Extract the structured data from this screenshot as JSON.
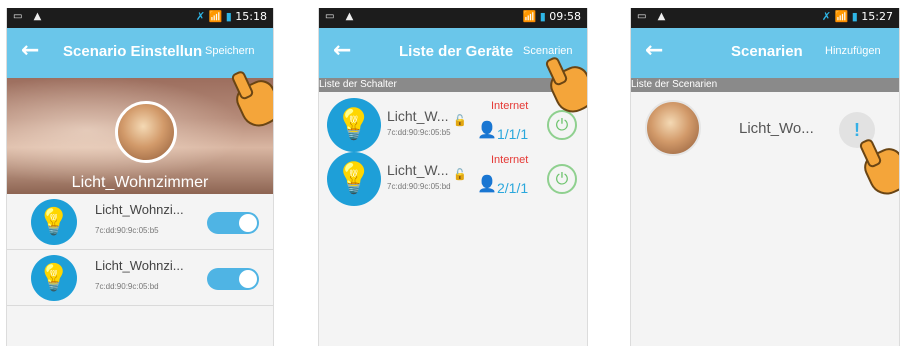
{
  "screens": [
    {
      "status": {
        "left_icons": "▭ ▲",
        "right_icons": "✗ 📶 ▮",
        "time": "15:18"
      },
      "appbar": {
        "back": "←",
        "title": "Scenario Einstellung",
        "action": "Speichern"
      },
      "scenario_name": "Licht_Wohnzimmer",
      "devices": [
        {
          "name": "Licht_Wohnzi...",
          "mac": "7c:dd:90:9c:05:b5",
          "on": true
        },
        {
          "name": "Licht_Wohnzi...",
          "mac": "7c:dd:90:9c:05:bd",
          "on": true
        }
      ]
    },
    {
      "status": {
        "left_icons": "▭ ▲",
        "right_icons": "📶 ▮",
        "time": "09:58"
      },
      "appbar": {
        "back": "←",
        "title": "Liste der Geräte",
        "action": "Scenarien"
      },
      "section": "Liste der Schalter",
      "devices": [
        {
          "name": "Licht_W...",
          "mac": "7c:dd:90:9c:05:b5",
          "connection": "Internet",
          "count": "1/1/1"
        },
        {
          "name": "Licht_W...",
          "mac": "7c:dd:90:9c:05:bd",
          "connection": "Internet",
          "count": "2/1/1"
        }
      ]
    },
    {
      "status": {
        "left_icons": "▭ ▲",
        "right_icons": "✗ 📶 ▮",
        "time": "15:27"
      },
      "appbar": {
        "back": "←",
        "title": "Scenarien",
        "action": "Hinzufügen"
      },
      "section": "Liste der Scenarien",
      "scenarios": [
        {
          "name": "Licht_Wo...",
          "badge": "!"
        }
      ]
    }
  ],
  "icons": {
    "bulb": "bulb-icon",
    "lock": "lock-icon",
    "person": "person-icon",
    "power": "power-icon",
    "hand": "pointing-hand-icon"
  },
  "colors": {
    "appbar": "#6ac6ea",
    "bulb": "#1e9fd8",
    "toggle": "#4fb4e4",
    "internet": "#e53935",
    "power": "#6cc36c"
  }
}
